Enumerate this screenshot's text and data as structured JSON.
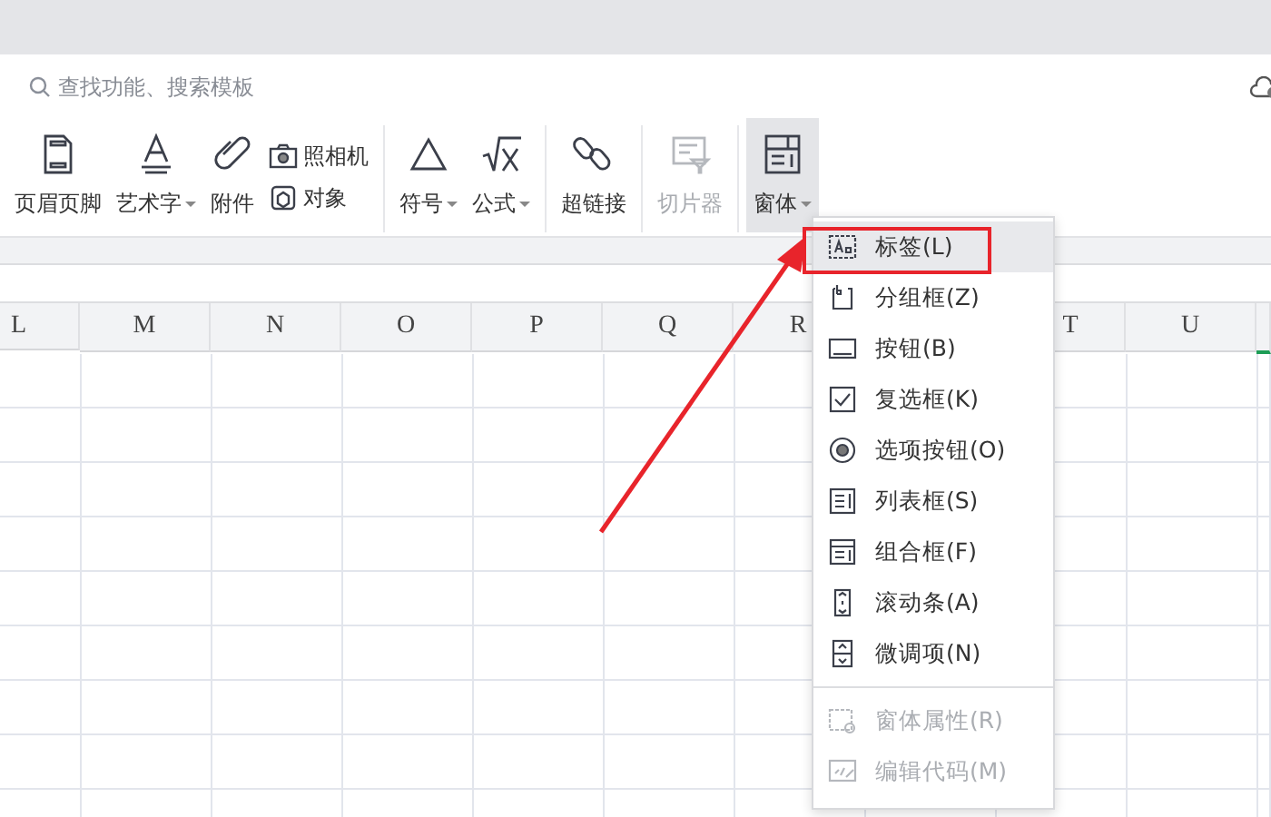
{
  "search": {
    "placeholder": "查找功能、搜索模板"
  },
  "ribbon": {
    "groups": [
      {
        "items": [
          {
            "kind": "large",
            "label": "页眉页脚",
            "caret": false,
            "disabled": false,
            "selected": false
          },
          {
            "kind": "large",
            "label": "艺术字",
            "caret": true,
            "disabled": false,
            "selected": false
          },
          {
            "kind": "large",
            "label": "附件",
            "caret": false,
            "disabled": false,
            "selected": false
          },
          {
            "kind": "pair",
            "entries": [
              {
                "label": "照相机"
              },
              {
                "label": "对象"
              }
            ]
          }
        ]
      },
      {
        "items": [
          {
            "kind": "large",
            "label": "符号",
            "caret": true,
            "disabled": false,
            "selected": false
          },
          {
            "kind": "large",
            "label": "公式",
            "caret": true,
            "disabled": false,
            "selected": false
          }
        ]
      },
      {
        "items": [
          {
            "kind": "large",
            "label": "超链接",
            "caret": false,
            "disabled": false,
            "selected": false
          }
        ]
      },
      {
        "items": [
          {
            "kind": "large",
            "label": "切片器",
            "caret": false,
            "disabled": true,
            "selected": false
          }
        ]
      },
      {
        "items": [
          {
            "kind": "large",
            "label": "窗体",
            "caret": true,
            "disabled": false,
            "selected": true
          }
        ]
      }
    ]
  },
  "sheet": {
    "columns": [
      {
        "label": "L"
      },
      {
        "label": "M"
      },
      {
        "label": "N"
      },
      {
        "label": "O"
      },
      {
        "label": "P"
      },
      {
        "label": "Q"
      },
      {
        "label": "R"
      },
      {},
      {
        "label": "T"
      },
      {
        "label": "U"
      }
    ]
  },
  "menu": {
    "sections": [
      [
        {
          "label": "标签(L)",
          "disabled": false,
          "selected": true
        },
        {
          "label": "分组框(Z)",
          "disabled": false,
          "selected": false
        },
        {
          "label": "按钮(B)",
          "disabled": false,
          "selected": false
        },
        {
          "label": "复选框(K)",
          "disabled": false,
          "selected": false
        },
        {
          "label": "选项按钮(O)",
          "disabled": false,
          "selected": false
        },
        {
          "label": "列表框(S)",
          "disabled": false,
          "selected": false
        },
        {
          "label": "组合框(F)",
          "disabled": false,
          "selected": false
        },
        {
          "label": "滚动条(A)",
          "disabled": false,
          "selected": false
        },
        {
          "label": "微调项(N)",
          "disabled": false,
          "selected": false
        }
      ],
      [
        {
          "label": "窗体属性(R)",
          "disabled": true,
          "selected": false
        },
        {
          "label": "编辑代码(M)",
          "disabled": true,
          "selected": false
        }
      ]
    ]
  }
}
